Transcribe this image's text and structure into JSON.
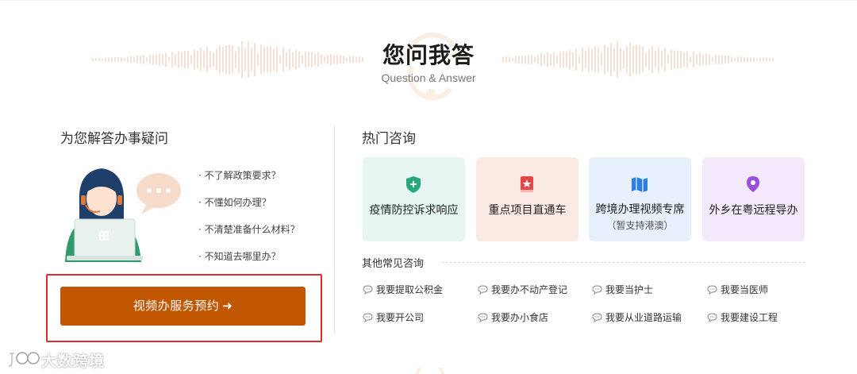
{
  "header": {
    "title": "您问我答",
    "subtitle": "Question & Answer"
  },
  "left": {
    "title": "为您解答办事疑问",
    "questions": [
      "· 不了解政策要求？",
      "· 不懂如何办理？",
      "· 不清楚准备什么材料？",
      "· 不知道去哪里办？"
    ],
    "book_button": "视频办服务预约",
    "book_arrow": "➜"
  },
  "right": {
    "title": "热门咨询",
    "cards": [
      {
        "label": "疫情防控诉求响应",
        "icon": "shield-plus-icon"
      },
      {
        "label": "重点项目直通车",
        "icon": "star-book-icon"
      },
      {
        "label": "跨境办理视频专席",
        "sub": "（暂支持港澳）",
        "icon": "map-icon"
      },
      {
        "label": "外乡在粤远程导办",
        "icon": "location-pin-icon"
      }
    ],
    "other_title": "其他常见咨询",
    "faqs": [
      "我要提取公积金",
      "我要办不动产登记",
      "我要当护士",
      "我要当医师",
      "我要开公司",
      "我要办小食店",
      "我要从业道路运输",
      "我要建设工程"
    ]
  },
  "watermark": {
    "text": "大数跨境"
  },
  "colors": {
    "accent": "#c05600",
    "highlight_frame": "#e02a2a",
    "card_green": "#e6f7f3",
    "card_red": "#fbe9e4",
    "card_blue": "#e7f0fb",
    "card_purple": "#f3e9fb"
  }
}
